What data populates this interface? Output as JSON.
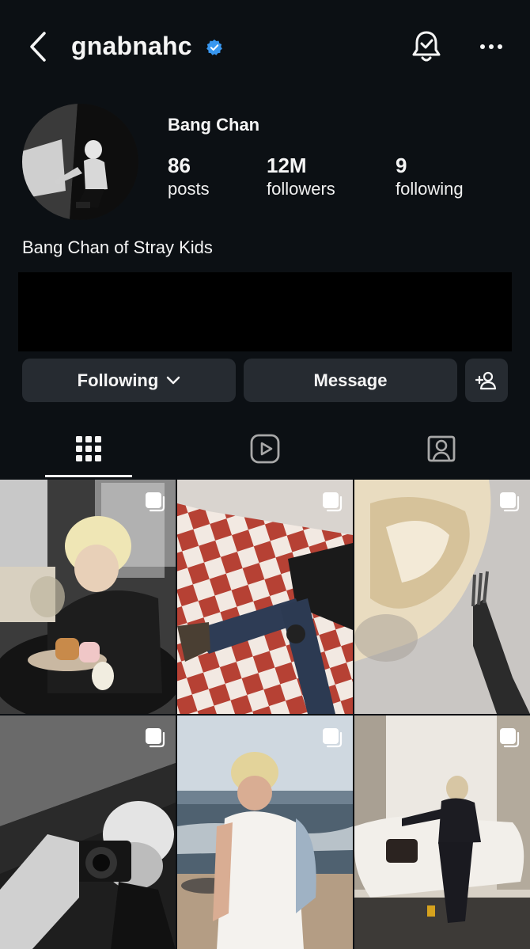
{
  "header": {
    "username": "gnabnahc",
    "verified": true,
    "icons": [
      "back-chevron-icon",
      "verified-badge-icon",
      "notification-bell-icon",
      "more-options-icon"
    ]
  },
  "profile": {
    "display_name": "Bang Chan",
    "bio": "Bang Chan of Stray Kids",
    "stats": {
      "posts": {
        "count": "86",
        "label": "posts"
      },
      "followers": {
        "count": "12M",
        "label": "followers"
      },
      "following": {
        "count": "9",
        "label": "following"
      }
    }
  },
  "actions": {
    "following_label": "Following",
    "message_label": "Message",
    "add_user_icon": "add-person-icon"
  },
  "tabs": [
    {
      "name": "posts-grid",
      "icon": "grid-icon",
      "active": true
    },
    {
      "name": "reels",
      "icon": "reels-icon",
      "active": false
    },
    {
      "name": "tagged",
      "icon": "tagged-user-icon",
      "active": false
    }
  ],
  "posts": [
    {
      "subject": "blonde man drinking at a cafe table",
      "multi": true
    },
    {
      "subject": "legs in jeans on red and white checkered floor",
      "multi": true
    },
    {
      "subject": "close-up of cake with a fork",
      "multi": true
    },
    {
      "subject": "black and white camera selfie",
      "multi": true
    },
    {
      "subject": "man at the beach in white tank top",
      "multi": true
    },
    {
      "subject": "man in dark suit seated on white sofa",
      "multi": true
    }
  ],
  "colors": {
    "background": "#0c1014",
    "button": "#262b31",
    "verified_blue": "#3897f0",
    "text": "#f5f5f5"
  }
}
